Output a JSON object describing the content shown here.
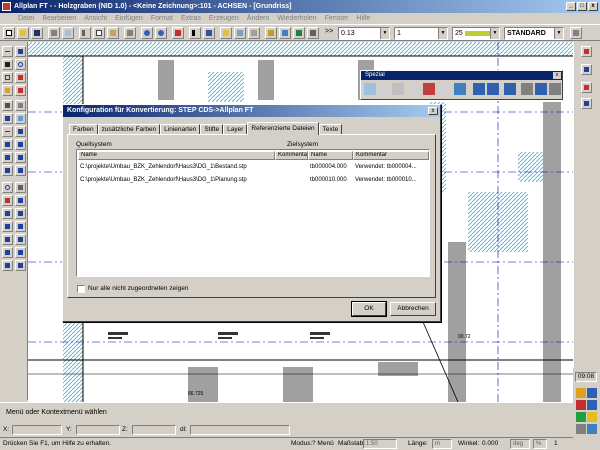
{
  "window": {
    "title": "Allplan FT  - - Holzgraben (NID  1.0) - <Keine Zeichnung>:101 - ACHSEN - [Grundriss]",
    "controls": [
      "_",
      "□",
      "x"
    ]
  },
  "menu": [
    "Datei",
    "Bearbeiten",
    "Ansicht",
    "Einfügen",
    "Format",
    "Extras",
    "Erzeugen",
    "Ändern",
    "Wiederholen",
    "Fenster",
    "Hilfe"
  ],
  "toolbar": {
    "scale_value": "0.13",
    "pen_value": "1",
    "line_value": "25",
    "style_value": "STANDARD",
    "chevron": ">>"
  },
  "spezial": {
    "title": "Spezial"
  },
  "dialog": {
    "title": "Konfiguration für Konvertierung: STEP CDS->Allplan FT",
    "tabs": [
      "Farben",
      "zusätzliche Farben",
      "Linienarten",
      "Stifte",
      "Layer",
      "Referenzierte Dateien",
      "Texte"
    ],
    "active_tab": 5,
    "source_label": "Quellsystem",
    "target_label": "Zielsystem",
    "columns": [
      "Name",
      "Kommentar",
      "Name",
      "Kommentar"
    ],
    "rows": [
      {
        "src_name": "C:\\projekte\\Umbau_BZK_Zehlendorf\\Haus3\\DG_1\\Bestand.stp",
        "src_comment": "",
        "tgt_name": "tb000004.000",
        "tgt_comment": "Verwendet: tb000004..."
      },
      {
        "src_name": "C:\\projekte\\Umbau_BZK_Zehlendorf\\Haus3\\DG_1\\Planung.stp",
        "src_comment": "",
        "tgt_name": "tb000010.000",
        "tgt_comment": "Verwendet: tb000010..."
      }
    ],
    "checkbox_label": "Nur alle nicht zugeordneten zeigen",
    "ok_label": "OK",
    "cancel_label": "Abbrechen"
  },
  "prompt": "Menü oder Kontextmenü wählen",
  "coords": {
    "x_label": "X:",
    "y_label": "Y:",
    "z_label": "Z:",
    "d_label": "dl:"
  },
  "status": {
    "help_text": "Drücken Sie F1, um Hilfe zu erhalten.",
    "modus_label": "Modus:",
    "modus_value": "? Menü",
    "massstab_label": "Maßstab:",
    "massstab_value": "1:50",
    "laenge_label": "Länge:",
    "laenge_value": "m",
    "winkel_label": "Winkel:",
    "winkel_value": "0.000",
    "deg_value": "deg",
    "pct_value": "%",
    "num_value": "1"
  },
  "tray": {
    "clock": "09:08"
  },
  "canvas": {
    "label_1": "00.72",
    "label_2": "86.725"
  },
  "colors": {
    "title_start": "#0a246a",
    "title_end": "#a6caf0",
    "hatch": "#3ab0d8",
    "wall": "#a0a0a0",
    "axis": "#0000c0"
  }
}
